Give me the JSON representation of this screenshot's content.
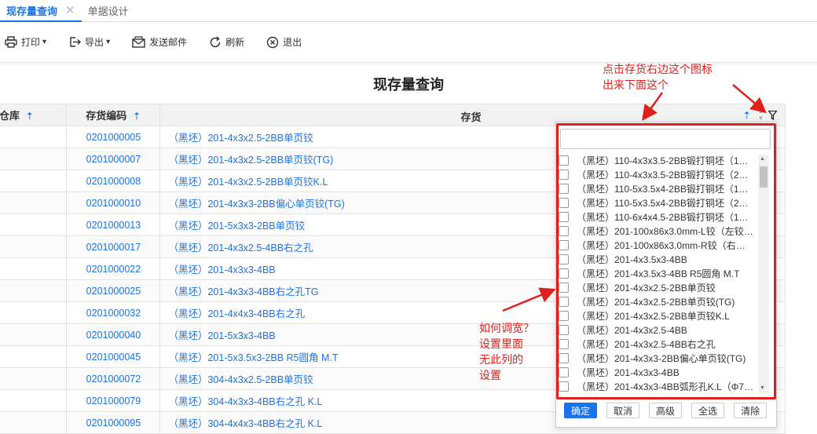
{
  "tabs": [
    {
      "label": "现存量查询",
      "active": true
    },
    {
      "label": "单据设计",
      "active": false
    }
  ],
  "toolbar": {
    "print": "打印",
    "export": "导出",
    "email": "发送邮件",
    "refresh": "刷新",
    "exit": "退出"
  },
  "page_title": "现存量查询",
  "annotations": {
    "top": [
      "点击存货右边这个图标",
      "出来下面这个"
    ],
    "middle": [
      "如何调宽？",
      "设置里面",
      "无此列的",
      "设置"
    ]
  },
  "table": {
    "headers": {
      "warehouse": "仓库",
      "code": "存货编码",
      "inventory": "存货"
    },
    "rows": [
      {
        "code": "0201000005",
        "name": "（黑坯）201-4x3x2.5-2BB单页铰"
      },
      {
        "code": "0201000007",
        "name": "（黑坯）201-4x3x2.5-2BB单页铰(TG)"
      },
      {
        "code": "0201000008",
        "name": "（黑坯）201-4x3x2.5-2BB单页铰K.L"
      },
      {
        "code": "0201000010",
        "name": "（黑坯）201-4x3x3-2BB偏心单页铰(TG)"
      },
      {
        "code": "0201000013",
        "name": "（黑坯）201-5x3x3-2BB单页铰"
      },
      {
        "code": "0201000017",
        "name": "（黑坯）201-4x3x2.5-4BB右之孔"
      },
      {
        "code": "0201000022",
        "name": "（黑坯）201-4x3x3-4BB"
      },
      {
        "code": "0201000025",
        "name": "（黑坯）201-4x3x3-4BB右之孔TG"
      },
      {
        "code": "0201000032",
        "name": "（黑坯）201-4x4x3-4BB右之孔"
      },
      {
        "code": "0201000040",
        "name": "（黑坯）201-5x3x3-4BB"
      },
      {
        "code": "0201000045",
        "name": "（黑坯）201-5x3.5x3-2BB R5圆角 M.T"
      },
      {
        "code": "0201000072",
        "name": "（黑坯）304-4x3x2.5-2BB单页铰"
      },
      {
        "code": "0201000079",
        "name": "（黑坯）304-4x3x3-4BB右之孔 K.L"
      },
      {
        "code": "0201000095",
        "name": "（黑坯）304-4x4x3-4BB右之孔 K.L"
      }
    ]
  },
  "filter_popup": {
    "search_value": "",
    "items": [
      "（黑坯）110-4x3x3.5-2BB锻打铜坯（1…",
      "（黑坯）110-4x3x3.5-2BB锻打铜坯（2…",
      "（黑坯）110-5x3.5x4-2BB锻打铜坯（1…",
      "（黑坯）110-5x3.5x4-2BB锻打铜坯（2…",
      "（黑坯）110-6x4x4.5-2BB锻打铜坯（1…",
      "（黑坯）201-100x86x3.0mm-L铰（左铰…",
      "（黑坯）201-100x86x3.0mm-R铰（右…",
      "（黑坯）201-4x3.5x3-4BB",
      "（黑坯）201-4x3.5x3-4BB R5圆角 M.T",
      "（黑坯）201-4x3x2.5-2BB单页铰",
      "（黑坯）201-4x3x2.5-2BB单页铰(TG)",
      "（黑坯）201-4x3x2.5-2BB单页铰K.L",
      "（黑坯）201-4x3x2.5-4BB",
      "（黑坯）201-4x3x2.5-4BB右之孔",
      "（黑坯）201-4x3x3-2BB偏心单页铰(TG)",
      "（黑坯）201-4x3x3-4BB",
      "（黑坯）201-4x3x3-4BB弧形孔K.L（Φ7…"
    ],
    "buttons": {
      "ok": "确定",
      "cancel": "取消",
      "advanced": "高级",
      "select_all": "全选",
      "clear": "清除"
    }
  },
  "colors": {
    "accent": "#1a73e8",
    "annotation": "#e0201a"
  }
}
